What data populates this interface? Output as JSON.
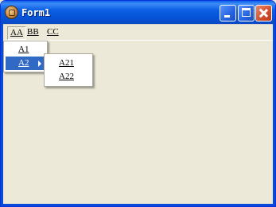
{
  "window": {
    "title": "Form1"
  },
  "menubar": {
    "items": [
      "AA",
      "BB",
      "CC"
    ]
  },
  "menu_aa": {
    "items": [
      "A1",
      "A2"
    ]
  },
  "submenu_a2": {
    "items": [
      "A21",
      "A22"
    ]
  },
  "colors": {
    "titlebar": "#0553d6",
    "menu_highlight": "#316ac5",
    "window_bg": "#ece9d8",
    "close_button": "#d1512f"
  }
}
